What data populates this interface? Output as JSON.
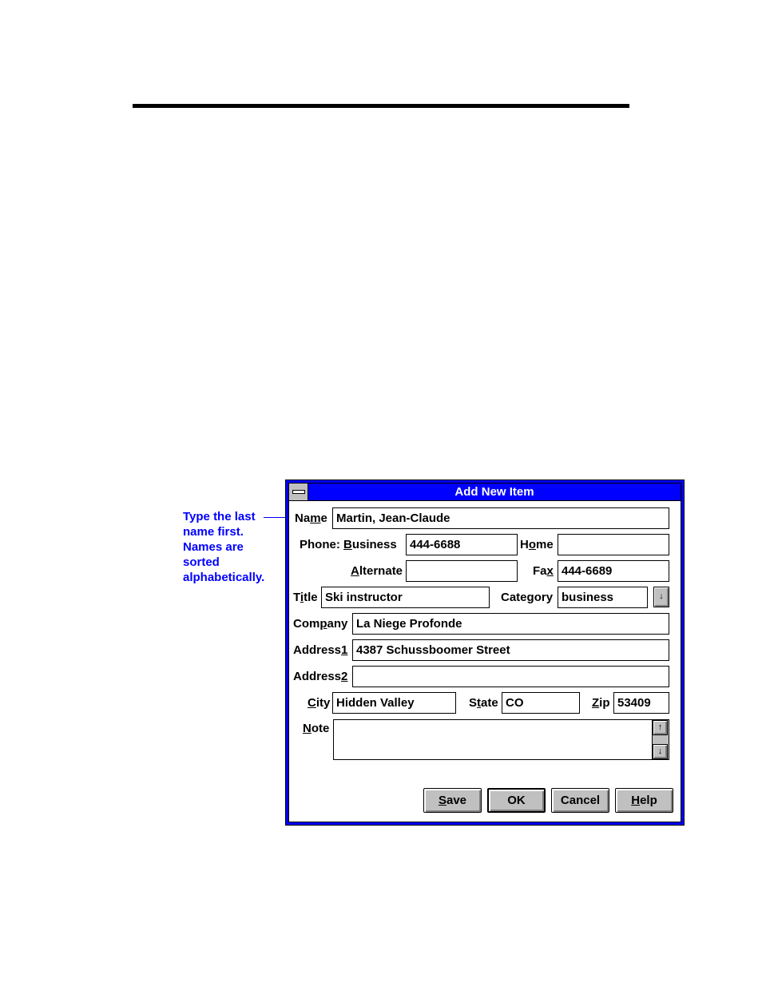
{
  "callout": {
    "lines": [
      "Type the last",
      "name first.",
      "Names are",
      "sorted",
      "alphabetically."
    ]
  },
  "dialog": {
    "title": "Add New Item",
    "system_menu_icon": "system-menu-icon",
    "fields": {
      "name": {
        "label_pre": "Na",
        "label_ul": "m",
        "label_post": "e",
        "value": "Martin, Jean-Claude"
      },
      "phone_prefix": "Phone: ",
      "business": {
        "label_pre": "",
        "label_ul": "B",
        "label_post": "usiness",
        "value": "444-6688"
      },
      "home": {
        "label_pre": "H",
        "label_ul": "o",
        "label_post": "me",
        "value": ""
      },
      "alternate": {
        "label_pre": "",
        "label_ul": "A",
        "label_post": "lternate",
        "value": ""
      },
      "fax": {
        "label_pre": "Fa",
        "label_ul": "x",
        "label_post": "",
        "value": "444-6689"
      },
      "title": {
        "label_pre": "T",
        "label_ul": "i",
        "label_post": "tle",
        "value": "Ski instructor"
      },
      "category": {
        "label_pre": "Cate",
        "label_ul": "g",
        "label_post": "ory",
        "value": "business"
      },
      "company": {
        "label_pre": "Com",
        "label_ul": "p",
        "label_post": "any",
        "value": "La Niege Profonde"
      },
      "address1": {
        "label_pre": "Address",
        "label_ul": "1",
        "label_post": "",
        "value": "4387 Schussboomer Street"
      },
      "address2": {
        "label_pre": "Address",
        "label_ul": "2",
        "label_post": "",
        "value": ""
      },
      "city": {
        "label_pre": "",
        "label_ul": "C",
        "label_post": "ity",
        "value": "Hidden Valley"
      },
      "state": {
        "label_pre": "S",
        "label_ul": "t",
        "label_post": "ate",
        "value": "CO"
      },
      "zip": {
        "label_pre": "",
        "label_ul": "Z",
        "label_post": "ip",
        "value": "53409"
      },
      "note": {
        "label_pre": "",
        "label_ul": "N",
        "label_post": "ote",
        "value": ""
      }
    },
    "icons": {
      "dropdown": "↓",
      "scroll_up": "↑",
      "scroll_down": "↓"
    },
    "buttons": {
      "save": {
        "pre": "",
        "ul": "S",
        "post": "ave"
      },
      "ok": {
        "pre": "OK",
        "ul": "",
        "post": ""
      },
      "cancel": {
        "pre": "Cancel",
        "ul": "",
        "post": ""
      },
      "help": {
        "pre": "",
        "ul": "H",
        "post": "elp"
      }
    }
  }
}
